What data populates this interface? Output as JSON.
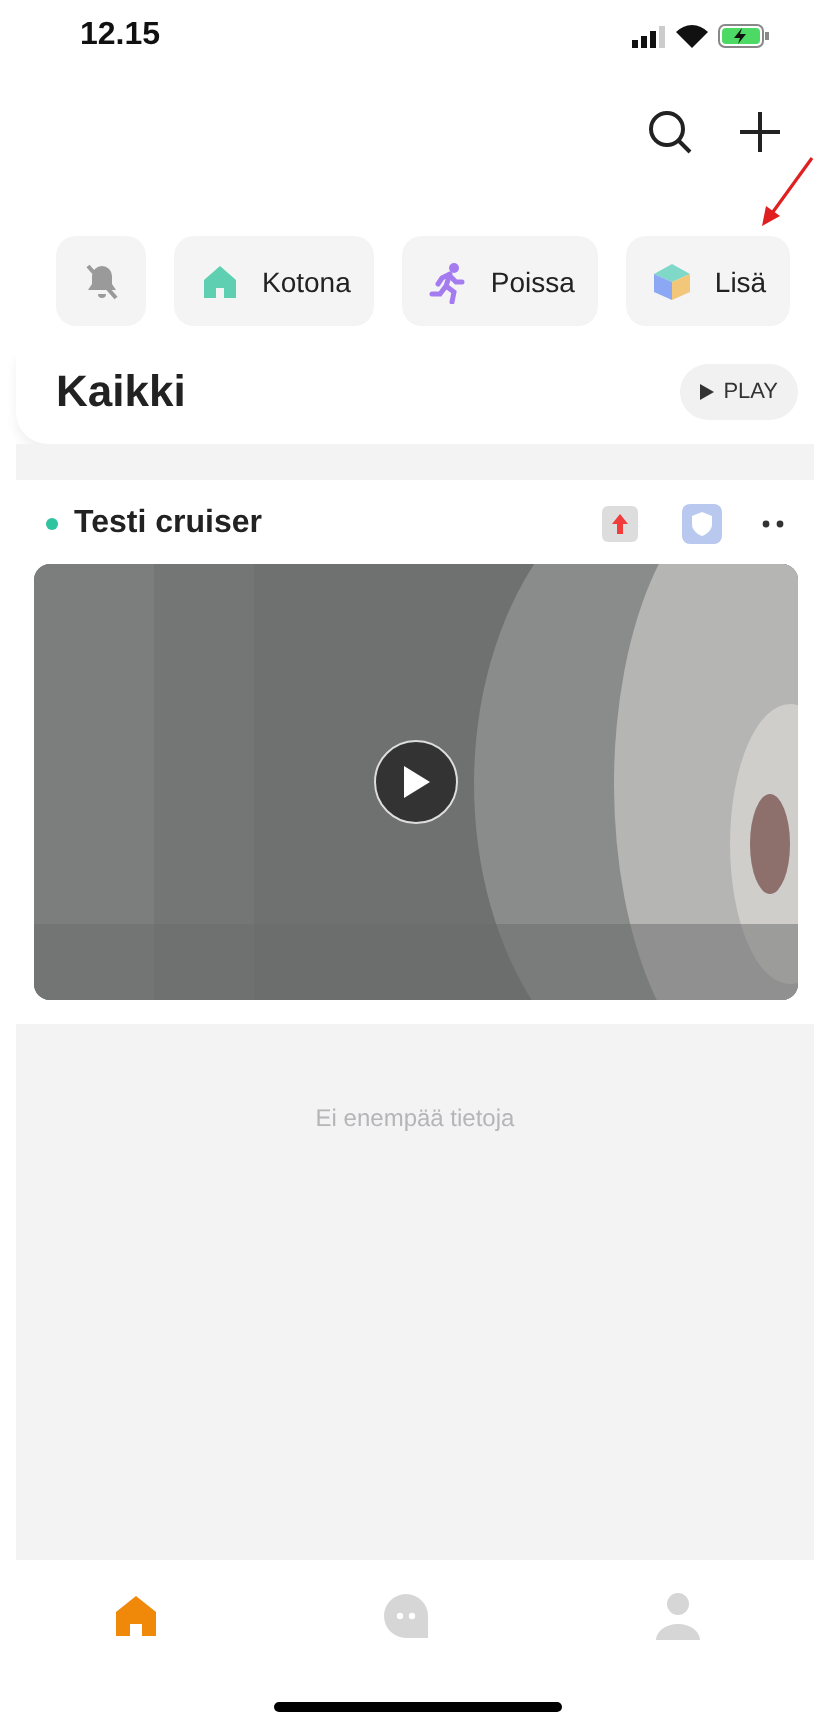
{
  "status_bar": {
    "time": "12.15"
  },
  "scenes": [
    {
      "kind": "mute"
    },
    {
      "kind": "home",
      "label": "Kotona"
    },
    {
      "kind": "away",
      "label": "Poissa"
    },
    {
      "kind": "more",
      "label": "Lisä"
    }
  ],
  "section": {
    "title": "Kaikki",
    "play_button": "PLAY"
  },
  "devices": [
    {
      "name": "Testi cruiser",
      "color": "#2ec4a0"
    }
  ],
  "empty_message": "Ei enempää tietoja",
  "tab_bar": [
    {
      "kind": "home",
      "selected": true
    },
    {
      "kind": "messages",
      "selected": false
    },
    {
      "kind": "profile",
      "selected": false
    }
  ]
}
